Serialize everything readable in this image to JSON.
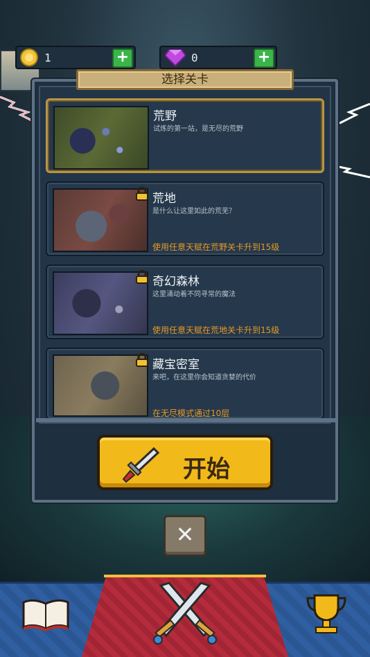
{
  "currency": {
    "coins": "1",
    "gems": "0"
  },
  "panel": {
    "title": "选择关卡"
  },
  "levels": [
    {
      "name": "荒野",
      "desc": "试炼的第一站，是无尽的荒野",
      "requirement": "",
      "locked": false,
      "selected": true
    },
    {
      "name": "荒地",
      "desc": "是什么让这里如此的荒芜？",
      "requirement": "使用任意天赋在荒野关卡升到15级",
      "locked": true,
      "selected": false
    },
    {
      "name": "奇幻森林",
      "desc": "这里涌动着不同寻常的魔法",
      "requirement": "使用任意天赋在荒地关卡升到15级",
      "locked": true,
      "selected": false
    },
    {
      "name": "藏宝密室",
      "desc": "来吧，在这里你会知道贪婪的代价",
      "requirement": "在无尽模式通过10层",
      "locked": true,
      "selected": false
    }
  ],
  "start_button": {
    "label": "开始"
  },
  "close_button": {
    "symbol": "✕"
  },
  "colors": {
    "accent_gold": "#f2b91a",
    "requirement_orange": "#e59a2a",
    "plus_green": "#3bb54a",
    "battle_red": "#b42b3b",
    "nav_blue": "#2f5fa0"
  },
  "icons": {
    "coin": "coin-icon",
    "gem": "gem-icon",
    "plus": "plus-icon",
    "lock": "lock-icon",
    "sword": "sword-icon",
    "close": "close-icon",
    "book": "book-icon",
    "crossed_swords": "crossed-swords-icon",
    "trophy": "trophy-icon"
  }
}
